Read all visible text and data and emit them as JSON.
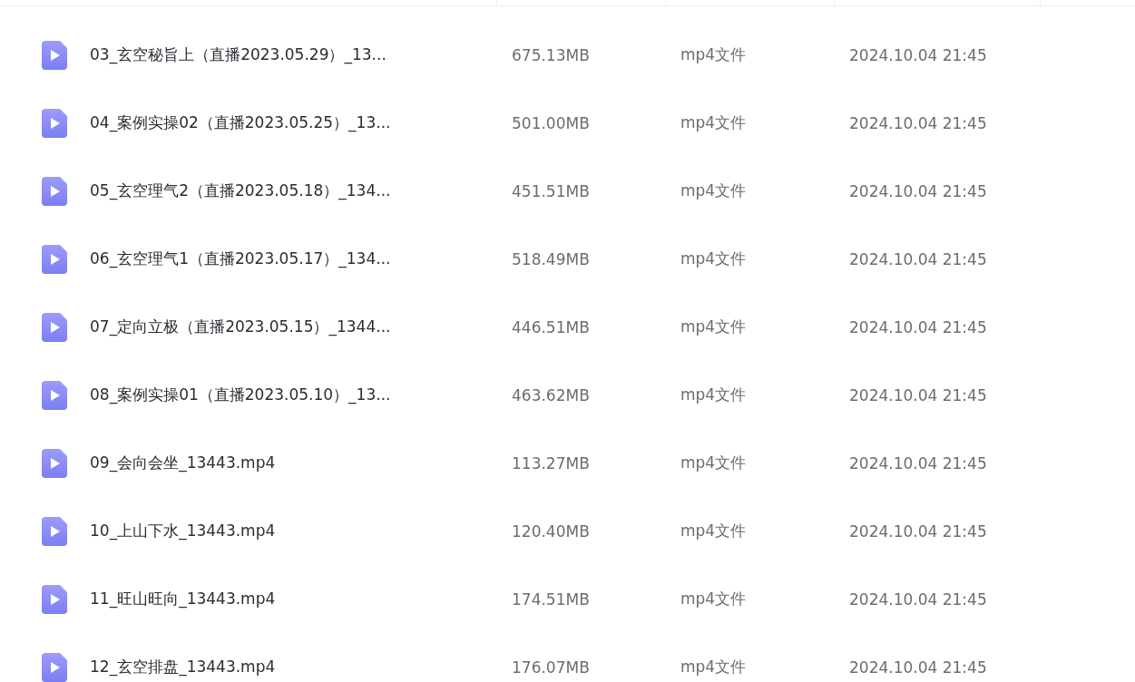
{
  "files": [
    {
      "name": "03_玄空秘旨上（直播2023.05.29）_13...",
      "size": "675.13MB",
      "type": "mp4文件",
      "modified": "2024.10.04 21:45"
    },
    {
      "name": "04_案例实操02（直播2023.05.25）_13...",
      "size": "501.00MB",
      "type": "mp4文件",
      "modified": "2024.10.04 21:45"
    },
    {
      "name": "05_玄空理气2（直播2023.05.18）_134...",
      "size": "451.51MB",
      "type": "mp4文件",
      "modified": "2024.10.04 21:45"
    },
    {
      "name": "06_玄空理气1（直播2023.05.17）_134...",
      "size": "518.49MB",
      "type": "mp4文件",
      "modified": "2024.10.04 21:45"
    },
    {
      "name": "07_定向立极（直播2023.05.15）_1344...",
      "size": "446.51MB",
      "type": "mp4文件",
      "modified": "2024.10.04 21:45"
    },
    {
      "name": "08_案例实操01（直播2023.05.10）_13...",
      "size": "463.62MB",
      "type": "mp4文件",
      "modified": "2024.10.04 21:45"
    },
    {
      "name": "09_会向会坐_13443.mp4",
      "size": "113.27MB",
      "type": "mp4文件",
      "modified": "2024.10.04 21:45"
    },
    {
      "name": "10_上山下水_13443.mp4",
      "size": "120.40MB",
      "type": "mp4文件",
      "modified": "2024.10.04 21:45"
    },
    {
      "name": "11_旺山旺向_13443.mp4",
      "size": "174.51MB",
      "type": "mp4文件",
      "modified": "2024.10.04 21:45"
    },
    {
      "name": "12_玄空排盘_13443.mp4",
      "size": "176.07MB",
      "type": "mp4文件",
      "modified": "2024.10.04 21:45"
    }
  ]
}
